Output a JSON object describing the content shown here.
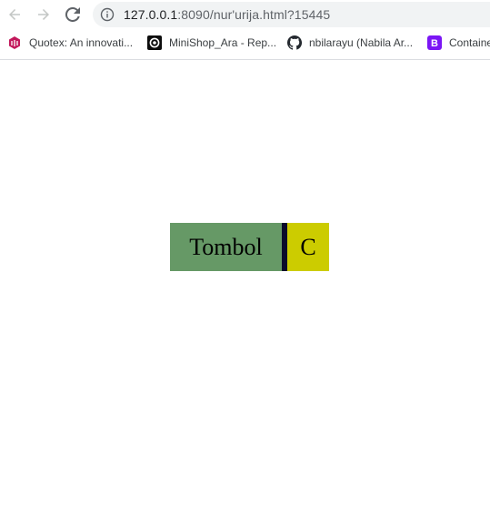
{
  "browser": {
    "url_host": "127.0.0.1",
    "url_path": ":8090/nur'urija.html?15445"
  },
  "bookmarks": [
    {
      "label": "Quotex: An innovati...",
      "icon": "quotex-icon"
    },
    {
      "label": "MiniShop_Ara - Rep...",
      "icon": "replit-icon"
    },
    {
      "label": "nbilarayu (Nabila Ar...",
      "icon": "github-icon"
    },
    {
      "label": "Containe",
      "icon": "bootstrap-icon"
    }
  ],
  "page": {
    "main_button_label": "Tombol",
    "side_button_label": "C"
  },
  "colors": {
    "main_button": "#669966",
    "divider": "#0a0a2a",
    "side_button": "#cccc00"
  }
}
